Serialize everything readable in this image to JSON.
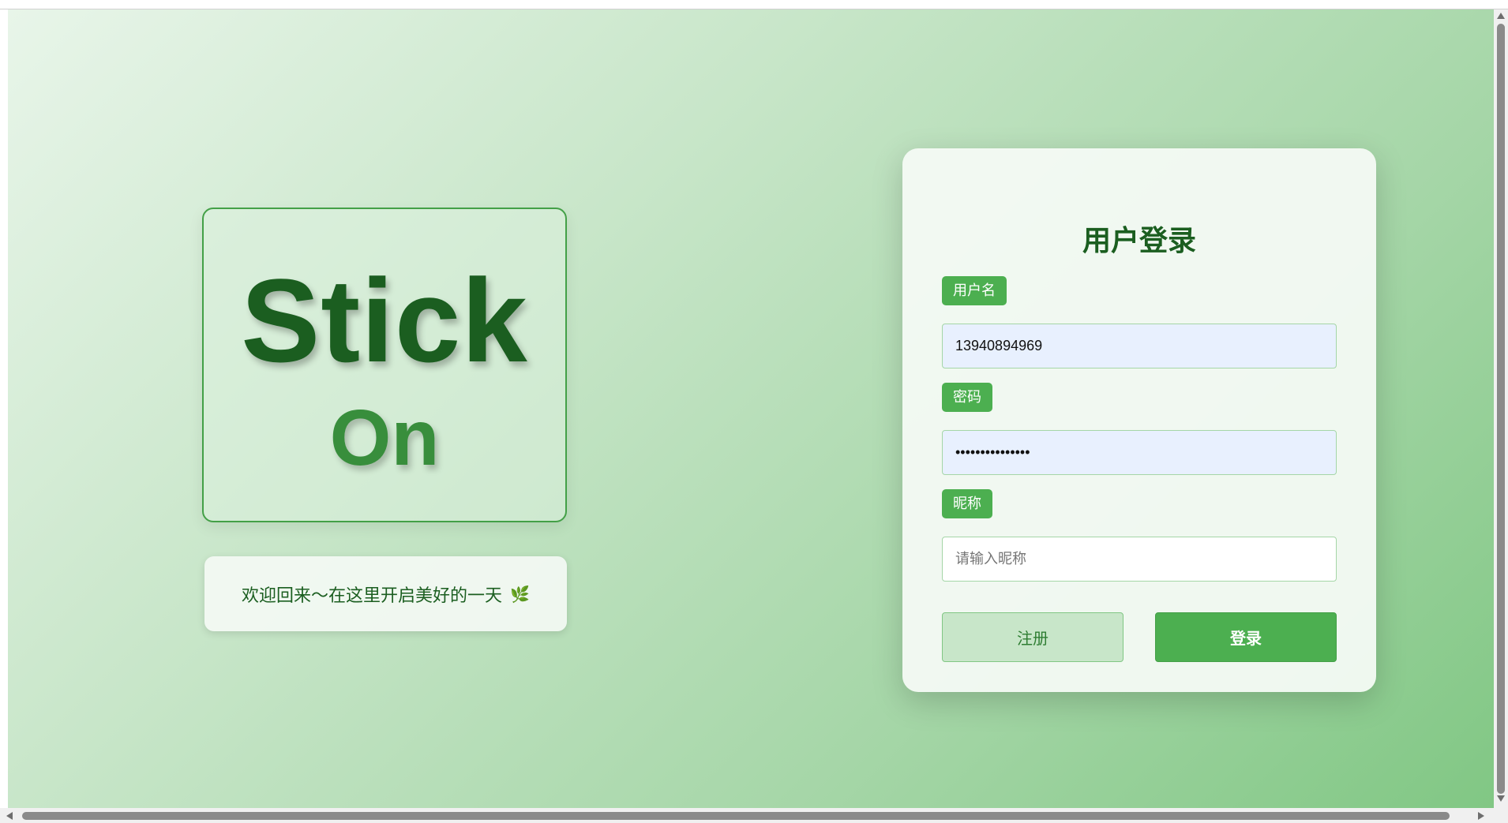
{
  "logo": {
    "line1": "Stick",
    "line2": "On"
  },
  "welcome": {
    "text": "欢迎回来～在这里开启美好的一天",
    "leaf_icon": "🌿"
  },
  "login_card": {
    "title": "用户登录",
    "username": {
      "label": "用户名",
      "value": "13940894969"
    },
    "password": {
      "label": "密码",
      "value": "•••••••••••••••"
    },
    "nickname": {
      "label": "昵称",
      "value": "",
      "placeholder": "请输入昵称"
    },
    "register_label": "注册",
    "login_label": "登录"
  },
  "colors": {
    "primary": "#4caf50",
    "dark_green": "#1b5e20",
    "autofill": "#e8f0fe"
  }
}
